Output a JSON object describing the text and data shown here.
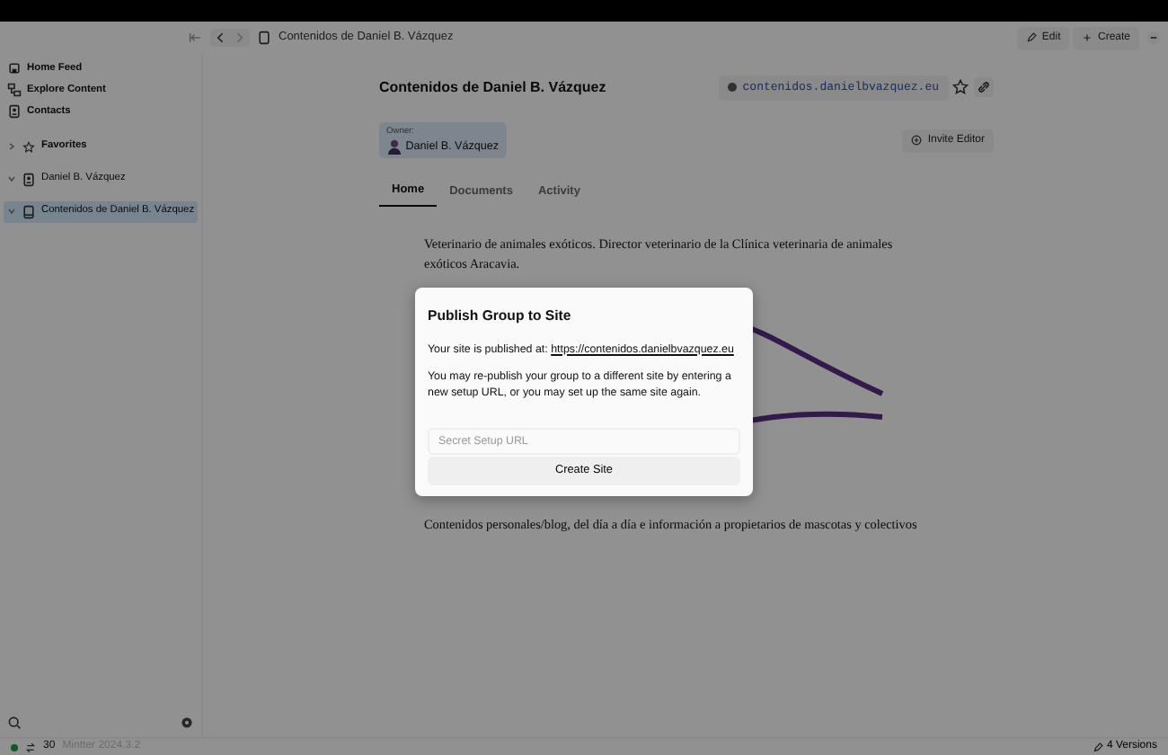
{
  "titlebar": {
    "title": "Contenidos de Daniel B. Vázquez",
    "buttons": [
      {
        "kind": "edit",
        "label": "Edit"
      },
      {
        "kind": "create",
        "label": "Create"
      }
    ]
  },
  "sidebar": {
    "nav": [
      {
        "kind": "home",
        "label": "Home Feed"
      },
      {
        "kind": "explore",
        "label": "Explore Content"
      },
      {
        "kind": "contacts",
        "label": "Contacts"
      }
    ],
    "tree": [
      {
        "kind": "favorites",
        "label": "Favorites",
        "expanded": false,
        "selected": false
      },
      {
        "kind": "account",
        "label": "Daniel B. Vázquez",
        "expanded": true,
        "selected": false
      },
      {
        "kind": "group",
        "label": "Contenidos de Daniel B. Vázquez",
        "expanded": true,
        "selected": true
      }
    ]
  },
  "page": {
    "title": "Contenidos de Daniel B. Vázquez",
    "site_url": "contenidos.danielbvazquez.eu",
    "owner_label": "Owner:",
    "owner_name": "Daniel B. Vázquez",
    "invite_button": "Invite Editor",
    "tabs": [
      {
        "label": "Home",
        "selected": true
      },
      {
        "label": "Documents",
        "selected": false
      },
      {
        "label": "Activity",
        "selected": false
      }
    ],
    "paragraphs": [
      "Veterinario de animales exóticos. Director veterinario de la Clínica veterinaria de animales exóticos Aracavia.",
      "Contenidos personales/blog, del día a día e información a propietarios de mascotas y colectivos"
    ]
  },
  "dialog": {
    "title": "Publish Group to Site",
    "published_label": "Your site is published at:",
    "published_url": "https://contenidos.danielbvazquez.eu",
    "description": "You may re-publish your group to a different site by entering a new setup URL, or you may set up the same site again.",
    "input": {
      "placeholder": "Secret Setup URL"
    },
    "button": "Create Site"
  },
  "status_bar": {
    "online": true,
    "sync_count": "30",
    "version": "Mintter 2024.3.2",
    "versions": "4 Versions"
  }
}
